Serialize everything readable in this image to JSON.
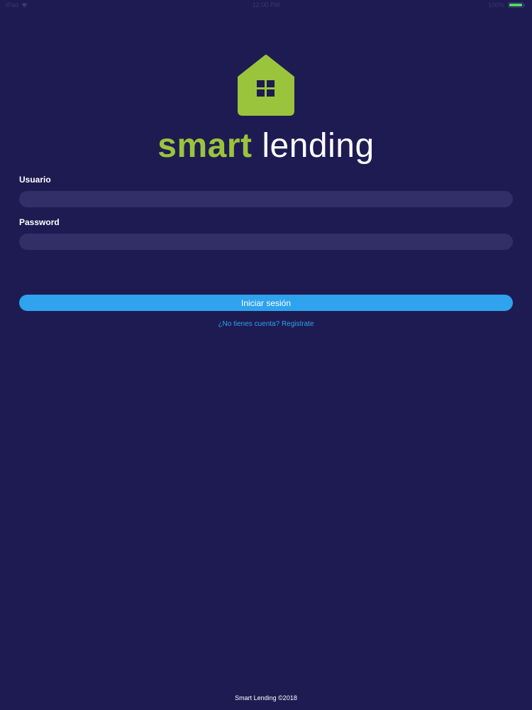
{
  "status_bar": {
    "carrier": "iPad",
    "time": "12:00 PM",
    "battery_label": "100%",
    "battery_level": 1.0,
    "battery_color": "#4cd964"
  },
  "brand": {
    "logo_icon": "house-icon",
    "name_part1": "smart",
    "name_part2": "lending",
    "accent_color": "#9ac43c",
    "background_color": "#1e1b52"
  },
  "form": {
    "username_label": "Usuario",
    "username_value": "",
    "password_label": "Password",
    "password_value": "",
    "login_label": "Iniciar sesión",
    "login_color": "#2fa3ee",
    "register_link": "¿No tienes cuenta? Registrate"
  },
  "footer": {
    "text": "Smart Lending ©2018"
  }
}
